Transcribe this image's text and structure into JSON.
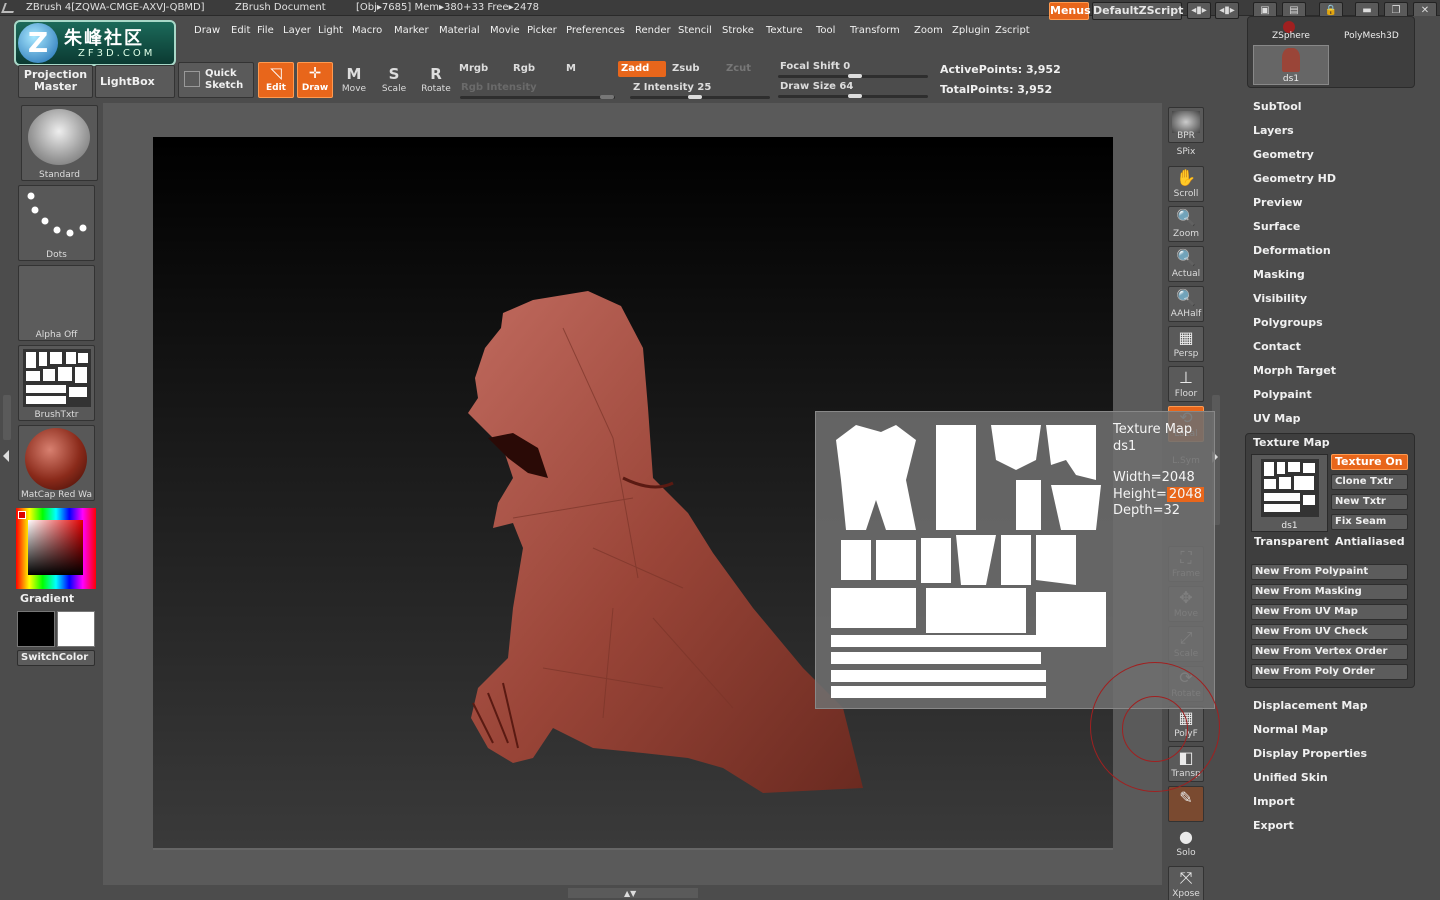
{
  "titlebar": {
    "app": "ZBrush 4[ZQWA-CMGE-AXVJ-QBMD]",
    "doc": "ZBrush Document",
    "stats": "[Obj▸7685] Mem▸380+33 Free▸2478",
    "menus_btn": "Menus",
    "script_btn": "DefaultZScript"
  },
  "logo": {
    "cn": "朱峰社区",
    "en": "ZF3D.COM",
    "letter": "Z"
  },
  "menubar": [
    "Draw",
    "Edit",
    "File",
    "Layer",
    "Light",
    "Macro",
    "Marker",
    "Material",
    "Movie",
    "Picker",
    "Preferences",
    "Render",
    "Stencil",
    "Stroke",
    "Texture",
    "Tool",
    "Transform",
    "Zoom",
    "Zplugin",
    "Zscript"
  ],
  "toolbar": {
    "projection_master": "Projection Master",
    "lightbox": "LightBox",
    "quick_sketch": "Quick Sketch",
    "edit": "Edit",
    "draw": "Draw",
    "move": "Move",
    "scale": "Scale",
    "rotate": "Rotate",
    "mrgb": "Mrgb",
    "rgb": "Rgb",
    "m": "M",
    "zadd": "Zadd",
    "zsub": "Zsub",
    "zcut": "Zcut",
    "rgb_intensity": "Rgb Intensity",
    "z_intensity_label": "Z Intensity",
    "z_intensity_value": "25",
    "focal_shift_label": "Focal Shift",
    "focal_shift_value": "0",
    "draw_size_label": "Draw Size",
    "draw_size_value": "64",
    "active_points": "ActivePoints: 3,952",
    "total_points": "TotalPoints: 3,952"
  },
  "leftshelf": {
    "brush": "Standard",
    "stroke": "Dots",
    "alpha": "Alpha  Off",
    "texture": "BrushTxtr",
    "material": "MatCap  Red  Wa",
    "gradient": "Gradient",
    "switchcolor": "SwitchColor"
  },
  "rightshelf": [
    {
      "name": "bpr",
      "label": "BPR",
      "glyph": ""
    },
    {
      "name": "spix",
      "label": "SPix",
      "glyph": ""
    },
    {
      "name": "scroll",
      "label": "Scroll",
      "glyph": "✋"
    },
    {
      "name": "zoom",
      "label": "Zoom",
      "glyph": "🔍"
    },
    {
      "name": "actual",
      "label": "Actual",
      "glyph": "🔍"
    },
    {
      "name": "aahalf",
      "label": "AAHalf",
      "glyph": "🔍"
    },
    {
      "name": "persp",
      "label": "Persp",
      "glyph": "▦"
    },
    {
      "name": "floor",
      "label": "Floor",
      "glyph": "⊥"
    },
    {
      "name": "local",
      "label": "Local",
      "glyph": "⟲"
    },
    {
      "name": "lsym",
      "label": "L.Sym",
      "glyph": "↔"
    },
    {
      "name": "xyz",
      "label": "",
      "glyph": "⟳"
    },
    {
      "name": "frame",
      "label": "Frame",
      "glyph": "⛶"
    },
    {
      "name": "move",
      "label": "Move",
      "glyph": "✥"
    },
    {
      "name": "scale",
      "label": "Scale",
      "glyph": "⤢"
    },
    {
      "name": "rotate",
      "label": "Rotate",
      "glyph": "⟳"
    },
    {
      "name": "polyf",
      "label": "PolyF",
      "glyph": "▦"
    },
    {
      "name": "transp",
      "label": "Transp",
      "glyph": "◧"
    },
    {
      "name": "ghost",
      "label": "",
      "glyph": "✎"
    },
    {
      "name": "solo",
      "label": "Solo",
      "glyph": "●"
    },
    {
      "name": "xpose",
      "label": "Xpose",
      "glyph": "⤧"
    }
  ],
  "tooltip": {
    "title": "Texture Map",
    "name": "ds1",
    "width": "Width=2048",
    "height_label": "Height=",
    "height_value": "2048",
    "depth": "Depth=32"
  },
  "panel": {
    "tool_zsphere": "ZSphere",
    "tool_polymesh": "PolyMesh3D",
    "tool_ds1": "ds1",
    "items": [
      "SubTool",
      "Layers",
      "Geometry",
      "Geometry HD",
      "Preview",
      "Surface",
      "Deformation",
      "Masking",
      "Visibility",
      "Polygroups",
      "Contact",
      "Morph Target",
      "Polypaint",
      "UV Map"
    ],
    "texture_map_title": "Texture Map",
    "texture_thumb_label": "ds1",
    "texture_on": "Texture On",
    "clone_txtr": "Clone Txtr",
    "new_txtr": "New Txtr",
    "fix_seam": "Fix Seam",
    "transparent": "Transparent",
    "antialiased": "Antialiased",
    "new_from": [
      "New From Polypaint",
      "New From Masking",
      "New From UV Map",
      "New From UV Check",
      "New From Vertex Order",
      "New From Poly Order"
    ],
    "items2": [
      "Displacement Map",
      "Normal Map",
      "Display Properties",
      "Unified Skin",
      "Import",
      "Export"
    ]
  },
  "colors": {
    "accent": "#e8661b",
    "model": "#9c4a40",
    "panel": "#4c4c4c"
  }
}
